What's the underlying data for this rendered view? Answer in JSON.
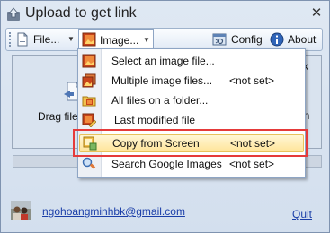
{
  "window": {
    "title": "Upload to get link",
    "close_glyph": "✕"
  },
  "toolbar": {
    "file_label": "File...",
    "image_label": "Image...",
    "config_label": "Config",
    "about_label": "About",
    "caret": "▼"
  },
  "main": {
    "drag_label": "Drag file",
    "right_text_1": "k",
    "right_text_2": "en"
  },
  "menu": {
    "items": [
      {
        "label": "Select an image file...",
        "value": "",
        "icon": "image-icon"
      },
      {
        "label": "Multiple image files...",
        "value": "<not set>",
        "icon": "images-icon"
      },
      {
        "label": "All files on a folder...",
        "value": "",
        "icon": "folder-icon"
      },
      {
        "label": "Last modified file",
        "value": "",
        "icon": "edit-image-icon"
      },
      {
        "label": "Copy from Screen",
        "value": "<not set>",
        "icon": "screen-capture-icon"
      },
      {
        "label": "Search Google Images",
        "value": "<not set>",
        "icon": "search-icon"
      }
    ],
    "selected_index": 4
  },
  "footer": {
    "email": "ngohoangminhbk@gmail.com",
    "quit_label": "Quit"
  },
  "colors": {
    "link": "#1a3ea8",
    "highlight_border": "#e53a3a",
    "selected_bg": "#ffe59a"
  }
}
